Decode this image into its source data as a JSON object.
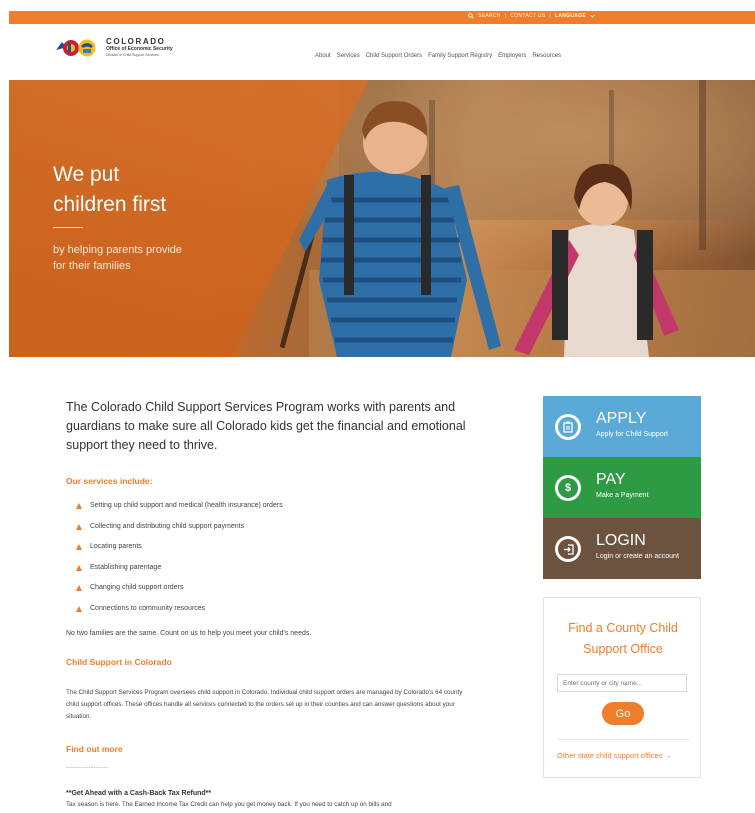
{
  "topbar": {
    "search_label": "SEARCH",
    "contact_label": "CONTACT US",
    "language_label": "LANGUAGE",
    "color": "#ef7d2a"
  },
  "logo": {
    "line1": "COLORADO",
    "line2": "Office of Economic Security",
    "line3": "Division of Child Support Services"
  },
  "nav": {
    "items": [
      "About",
      "Services",
      "Child Support Orders",
      "Family Support Registry",
      "Employers",
      "Resources"
    ]
  },
  "hero": {
    "title_line1": "We put",
    "title_line2": "children first",
    "subtitle_line1": "by helping parents provide",
    "subtitle_line2": "for their families"
  },
  "main": {
    "intro": "The Colorado Child Support Services Program works with parents and guardians to make sure all Colorado kids get the financial and emotional support they need to thrive.",
    "services_heading": "Our services include:",
    "services": [
      "Setting up child support and medical (health insurance) orders",
      "Collecting and distributing child support payments",
      "Locating parents",
      "Establishing parentage",
      "Changing child support orders",
      "Connections to community resources"
    ],
    "note": "No two families are the same. Count on us to help you meet your child's needs.",
    "cs_heading": "Child Support in Colorado",
    "cs_body": "The Child Support Services Program oversees child support in Colorado. Individual child support orders are managed by Colorado's 64 county child support offices. These offices handle all services connected to the orders set up in their counties and can answer questions about your situation.",
    "find_more": "Find out more",
    "dashes": "-----------------",
    "tax_title": "**Get Ahead with a Cash-Back Tax Refund**",
    "tax_body": "Tax season is here. The Earned Income Tax Credit can help you get money back. If you need to catch up on bills and"
  },
  "tiles": {
    "apply": {
      "title": "APPLY",
      "subtitle": "Apply for Child Support",
      "color": "#5aa9d6",
      "icon": "clipboard-icon"
    },
    "pay": {
      "title": "PAY",
      "subtitle": "Make a Payment",
      "color": "#2e9a44",
      "icon": "dollar-icon"
    },
    "login": {
      "title": "LOGIN",
      "subtitle": "Login or create an account",
      "color": "#6b5340",
      "icon": "login-icon"
    }
  },
  "find_office": {
    "title_line1": "Find a County Child",
    "title_line2": "Support Office",
    "placeholder": "Enter county or city name...",
    "go_label": "Go",
    "other_link": "Other state child support offices →"
  },
  "colors": {
    "accent": "#ef7d2a"
  }
}
